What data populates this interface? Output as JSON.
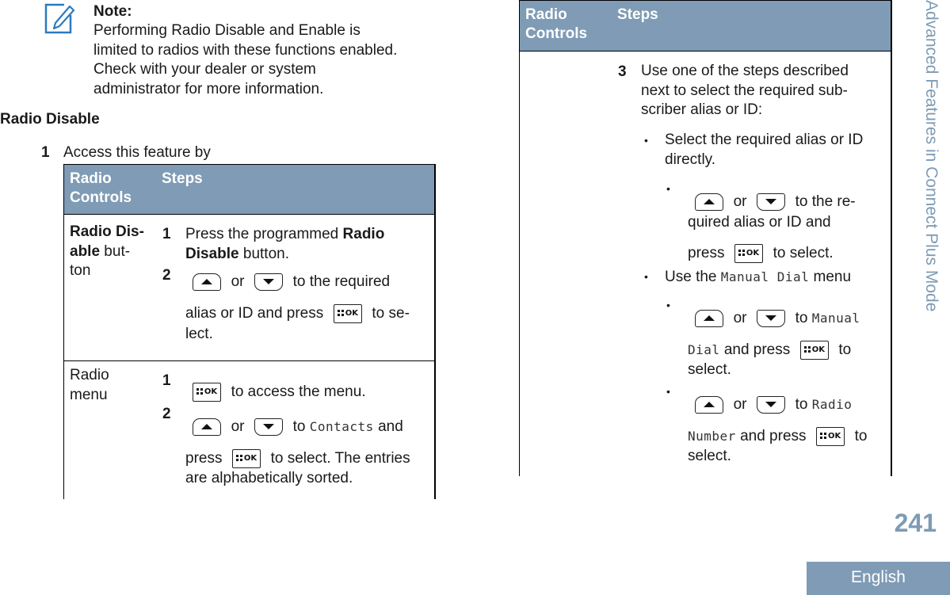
{
  "note": {
    "icon": "note-pencil-icon",
    "title": "Note:",
    "lines": [
      "Performing Radio Disable and Enable is",
      "limited to radios with these functions enabled.",
      "Check with your dealer or system",
      "administrator for more information."
    ]
  },
  "section": {
    "heading": "Radio Disable",
    "step1_num": "1",
    "step1_text": "Access this feature by"
  },
  "table_left": {
    "headers": [
      "Radio Controls",
      "Steps"
    ],
    "header_col1_line1": "Radio",
    "header_col1_line2": "Controls",
    "header_col2": "Steps",
    "rows": [
      {
        "control_bold": "Radio Dis-",
        "control_bold2": "able",
        "control_rest": " but-",
        "control_rest2": "ton",
        "steps": [
          {
            "num": "1",
            "pre": "Press the programmed ",
            "bold": "Radio",
            "bold2": "Disable",
            "post": " button."
          },
          {
            "num": "2",
            "or": "or",
            "after_keys": "to the required",
            "line2_pre": "alias or ID and press",
            "line2_post": "to se-",
            "line3": "lect."
          }
        ]
      },
      {
        "control_line1": "Radio",
        "control_line2": "menu",
        "steps": [
          {
            "num": "1",
            "text": "to access the menu."
          },
          {
            "num": "2",
            "or": "or",
            "to": "to",
            "menu_item": "Contacts",
            "and": "and",
            "line2_pre": "press",
            "line2_post": "to select. The entries",
            "line3": "are alphabetically sorted."
          }
        ]
      }
    ]
  },
  "table_right": {
    "header_col1_line1": "Radio",
    "header_col1_line2": "Controls",
    "header_col2": "Steps",
    "step3": {
      "num": "3",
      "lines": [
        "Use one of the steps described",
        "next to select the required sub-",
        "scriber alias or ID:"
      ],
      "bullets": [
        {
          "bullet": "•",
          "lines": [
            "Select the required alias or ID",
            "directly."
          ],
          "sub": {
            "bullet": "•",
            "or": "or",
            "after_keys": "to the re-",
            "line2": "quired alias or ID and",
            "line3_pre": "press",
            "line3_post": "to select."
          }
        },
        {
          "bullet": "•",
          "pre": "Use the ",
          "menu_item": "Manual Dial",
          "post": " menu",
          "subs": [
            {
              "bullet": "•",
              "or": "or",
              "to": "to",
              "menu_item_a": "Manual",
              "menu_item_b": "Dial",
              "line2_post_pre": "and press",
              "line2_post": "to",
              "line3": "select."
            },
            {
              "bullet": "•",
              "or": "or",
              "to": "to",
              "menu_item_a": "Radio",
              "menu_item_b": "Number",
              "line2_post_pre": "and press",
              "line2_post": "to",
              "line3": "select."
            }
          ]
        }
      ]
    }
  },
  "keys": {
    "up": "up-arrow-key-icon",
    "down": "down-arrow-key-icon",
    "ok_label": "OK"
  },
  "side": {
    "chapter_title": "Advanced Features in Connect Plus Mode",
    "page_number": "241",
    "language": "English"
  },
  "colors": {
    "accent": "#7f9bb5",
    "note_icon": "#2b7bc0"
  }
}
